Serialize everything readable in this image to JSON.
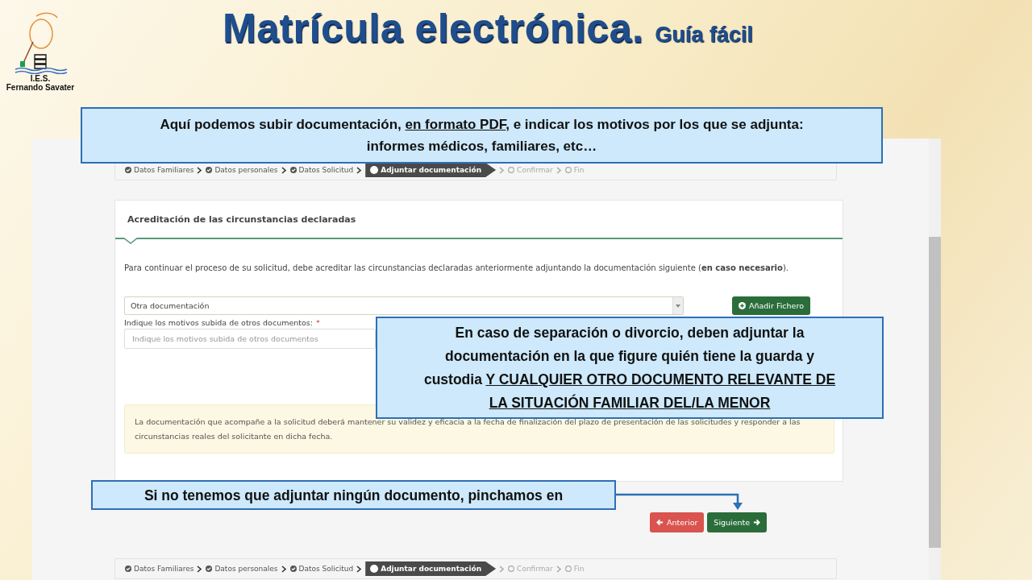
{
  "logo": {
    "lines": [
      "I.E.S.",
      "Fernando Savater"
    ]
  },
  "title": {
    "main": "Matrícula electrónica.",
    "sub": "Guía fácil"
  },
  "steps_top": [
    {
      "label": "Datos Familiares",
      "completed": true,
      "selected": false
    },
    {
      "label": "Datos personales",
      "completed": true,
      "selected": false
    },
    {
      "label": "Datos Solicitud",
      "completed": true,
      "selected": false
    },
    {
      "label": "Adjuntar documentación",
      "completed": false,
      "selected": true
    },
    {
      "label": "Confirmar",
      "completed": false,
      "selected": false
    },
    {
      "label": "Fin",
      "completed": false,
      "selected": false
    }
  ],
  "card": {
    "title": "Acreditación de las circunstancias declaradas",
    "intro": "Para continuar el proceso de su solicitud, debe acreditar las circunstancias declaradas anteriormente adjuntando la documentación siguiente (**en caso necesario**).",
    "select_value": "Otra documentación",
    "add_button": "Añadir Fichero",
    "reason_label": "Indique los motivos subida de otros documentos:",
    "required_mark": "*",
    "reason_placeholder": "Indique los motivos subida de otros documentos",
    "notice": "La documentación que acompañe a la solicitud deberá mantener su validez y eficacia a la fecha de finalización del plazo de presentación de las solicitudes y responder a las circunstancias reales del solicitante en dicha fecha."
  },
  "nav_buttons": [
    {
      "label": "Anterior",
      "kind": "back"
    },
    {
      "label": "Siguiente",
      "kind": "next"
    }
  ],
  "steps_bottom": [
    {
      "label": "Datos Familiares",
      "completed": true,
      "selected": false
    },
    {
      "label": "Datos personales",
      "completed": true,
      "selected": false
    },
    {
      "label": "Datos Solicitud",
      "completed": true,
      "selected": false
    },
    {
      "label": "Adjuntar documentación",
      "completed": false,
      "selected": true
    },
    {
      "label": "Confirmar",
      "completed": false,
      "selected": false
    },
    {
      "label": "Fin",
      "completed": false,
      "selected": false
    }
  ],
  "callouts": [
    {
      "kind": "top",
      "parts": [
        {
          "text": "Aquí podemos subir documentación, ",
          "underline": false
        },
        {
          "text": "en formato PDF",
          "underline": true
        },
        {
          "text": ", e indicar los motivos por los que se adjunta: informes médicos, familiares, etc…",
          "underline": false
        }
      ]
    },
    {
      "kind": "middle",
      "parts": [
        {
          "text": "En caso de separación o divorcio, deben adjuntar la documentación en la que figure quién tiene la guarda y custodia ",
          "underline": false
        },
        {
          "text": "Y CUALQUIER OTRO DOCUMENTO RELEVANTE DE LA SITUACIÓN FAMILIAR DEL/LA MENOR",
          "underline": true
        }
      ]
    },
    {
      "kind": "bottom",
      "parts": [
        {
          "text": "Si no tenemos que adjuntar ningún documento, pinchamos en",
          "underline": false
        }
      ]
    }
  ]
}
